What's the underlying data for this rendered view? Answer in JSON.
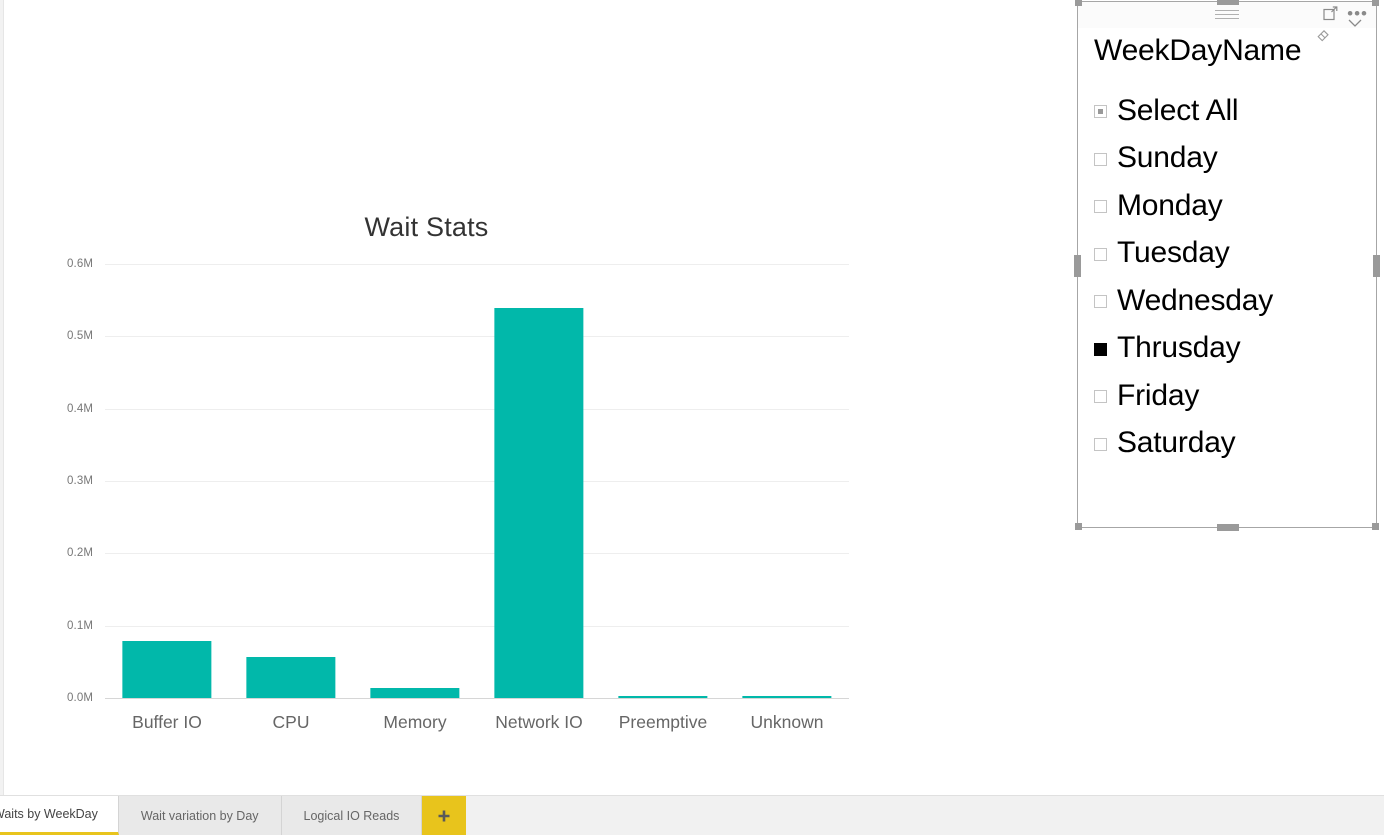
{
  "report": {
    "active_page": "Waits by WeekDay"
  },
  "chart_visual": {
    "title": "Wait Stats"
  },
  "chart_data": {
    "type": "bar",
    "title": "Wait Stats",
    "xlabel": "",
    "ylabel": "",
    "categories": [
      "Buffer IO",
      "CPU",
      "Memory",
      "Network IO",
      "Preemptive",
      "Unknown"
    ],
    "values": [
      0.079,
      0.057,
      0.014,
      0.539,
      0.003,
      0.003
    ],
    "value_unit": "M",
    "ylim": [
      0.0,
      0.6
    ],
    "yticks": [
      0.0,
      0.1,
      0.2,
      0.3,
      0.4,
      0.5,
      0.6
    ],
    "ytick_labels": [
      "0.0M",
      "0.1M",
      "0.2M",
      "0.3M",
      "0.4M",
      "0.5M",
      "0.6M"
    ],
    "grid": true,
    "legend": "none",
    "series_color": "#01B8AA"
  },
  "slicer": {
    "field_name": "WeekDayName",
    "header_icons": {
      "drag": "drag-handle-icon",
      "focus": "focus-mode-icon",
      "more": "more-options-icon"
    },
    "clear_icon": "eraser-icon",
    "expand_icon": "chevron-down-icon",
    "items": [
      {
        "label": "Select All",
        "state": "partial"
      },
      {
        "label": "Sunday",
        "state": "unchecked"
      },
      {
        "label": "Monday",
        "state": "unchecked"
      },
      {
        "label": "Tuesday",
        "state": "unchecked"
      },
      {
        "label": "Wednesday",
        "state": "unchecked"
      },
      {
        "label": "Thrusday",
        "state": "checked"
      },
      {
        "label": "Friday",
        "state": "unchecked"
      },
      {
        "label": "Saturday",
        "state": "unchecked"
      }
    ]
  },
  "tabbar": {
    "tabs": [
      {
        "label": "Waits by WeekDay",
        "active": true
      },
      {
        "label": "Wait variation by Day",
        "active": false
      },
      {
        "label": "Logical IO Reads",
        "active": false
      }
    ],
    "add_page_label": "+",
    "accent_color": "#E8C41C"
  }
}
